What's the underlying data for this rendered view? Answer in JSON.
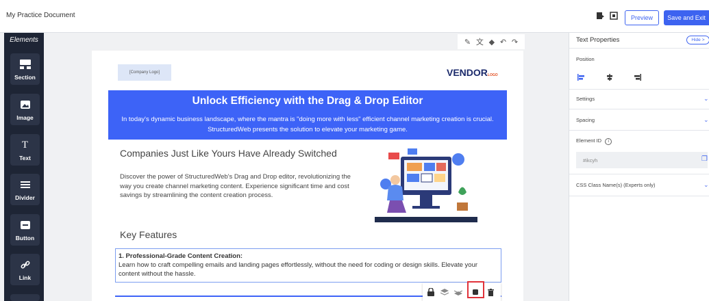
{
  "header": {
    "doc_title": "My Practice Document",
    "preview_label": "Preview",
    "save_exit_label": "Save and Exit"
  },
  "sidebar": {
    "title": "Elements",
    "items": [
      {
        "label": "Section",
        "icon": "section-icon"
      },
      {
        "label": "Image",
        "icon": "image-icon"
      },
      {
        "label": "Text",
        "icon": "text-icon"
      },
      {
        "label": "Divider",
        "icon": "divider-icon"
      },
      {
        "label": "Button",
        "icon": "button-icon"
      },
      {
        "label": "Link",
        "icon": "link-icon"
      }
    ]
  },
  "canvas": {
    "logo_placeholder": "[Company Logo]",
    "vendor_logo": "VENDOR",
    "vendor_logo_suffix": "LOGO",
    "hero_title": "Unlock Efficiency with the Drag & Drop Editor",
    "hero_text": "In today's dynamic business landscape, where the mantra is \"doing more with less\" efficient channel marketing creation is crucial. StructuredWeb presents the solution to elevate your marketing game.",
    "section_heading": "Companies Just Like Yours Have Already Switched",
    "section_text": "Discover the power of StructuredWeb's Drag and Drop editor, revolutionizing the way you create channel marketing content. Experience significant time and cost savings by streamlining the content creation process.",
    "features_heading": "Key Features",
    "feature_title": "1. Professional-Grade Content Creation:",
    "feature_text": "Learn how to craft compelling emails and landing pages effortlessly, without the need for coding or design skills. Elevate your content without the hassle."
  },
  "right_panel": {
    "title": "Text Properties",
    "hide_label": "Hide",
    "position_label": "Position",
    "settings_label": "Settings",
    "spacing_label": "Spacing",
    "element_id_label": "Element ID",
    "element_id_value": "#ikcyh",
    "css_class_label": "CSS Class Name(s) (Experts only)"
  },
  "colors": {
    "accent": "#3d63f0",
    "hero_bg": "#3d63f7",
    "sidebar_bg": "#1e2535",
    "highlight": "#e0323a"
  }
}
